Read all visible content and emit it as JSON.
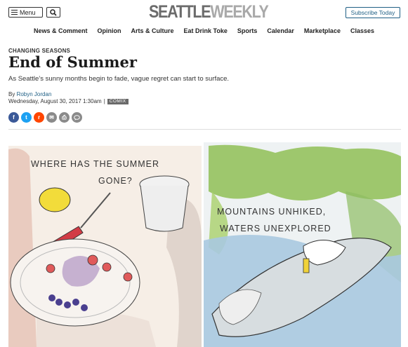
{
  "header": {
    "menu_label": "Menu",
    "logo_part1": "SEATTLE",
    "logo_part2": "WEEKLY",
    "subscribe_label": "Subscribe Today"
  },
  "nav": {
    "items": [
      "News & Comment",
      "Opinion",
      "Arts & Culture",
      "Eat Drink Toke",
      "Sports",
      "Calendar",
      "Marketplace",
      "Classes"
    ]
  },
  "article": {
    "kicker": "CHANGING SEASONS",
    "title": "End of Summer",
    "dek": "As Seattle’s sunny months begin to fade, vague regret can start to surface.",
    "by_prefix": "By",
    "author": "Robyn Jordan",
    "date": "Wednesday, August 30, 2017 1:30am",
    "separator": "|",
    "tag": "COMIX"
  },
  "share": {
    "buttons": [
      {
        "icon": "facebook-icon",
        "glyph": "f",
        "color": "#3b5998"
      },
      {
        "icon": "twitter-icon",
        "glyph": "t",
        "color": "#1da1f2"
      },
      {
        "icon": "reddit-icon",
        "glyph": "r",
        "color": "#ff4500"
      },
      {
        "icon": "email-icon",
        "glyph": "✉",
        "color": "#8a8a8a"
      },
      {
        "icon": "print-icon",
        "glyph": "⎙",
        "color": "#8a8a8a"
      },
      {
        "icon": "comment-icon",
        "glyph": "💬",
        "color": "#8a8a8a"
      }
    ]
  },
  "comic": {
    "caption_left_line1": "WHERE HAS THE SUMMER",
    "caption_left_line2": "GONE?",
    "caption_right_line1": "MOUNTAINS UNHIKED,",
    "caption_right_line2": "WATERS UNEXPLORED"
  }
}
